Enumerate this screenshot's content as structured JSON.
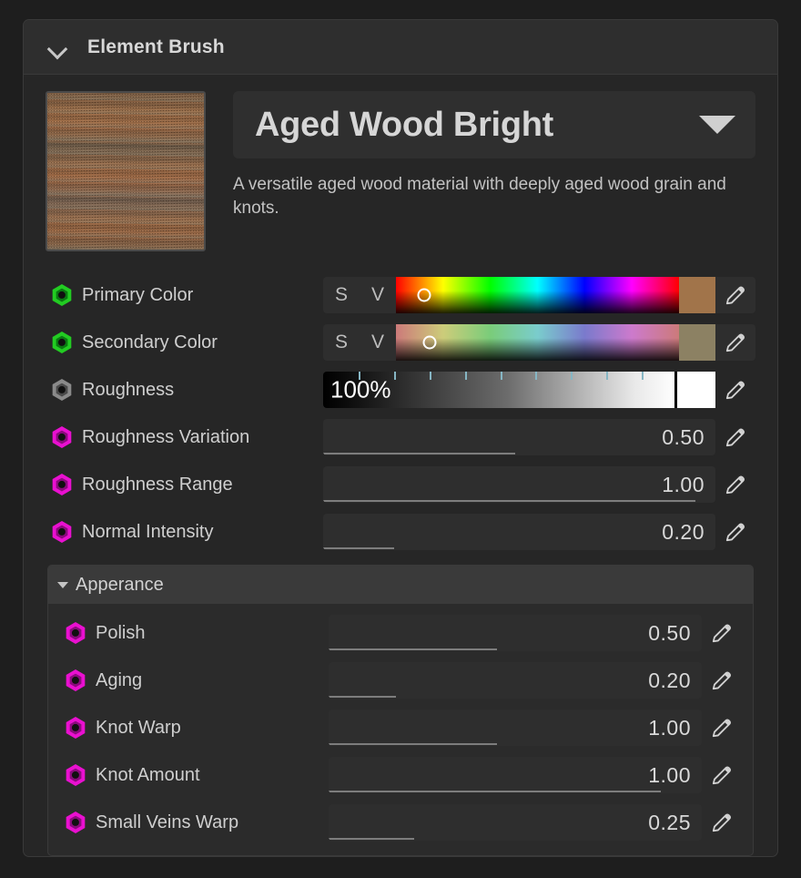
{
  "panel": {
    "title": "Element Brush",
    "collapse_icon": "chevron-down-icon"
  },
  "material": {
    "name": "Aged Wood Bright",
    "description": "A versatile aged wood material with deeply aged wood grain and knots.",
    "dropdown_icon": "caret-down-icon",
    "thumbnail_alt": "aged wood texture preview"
  },
  "colors": {
    "s_label": "S",
    "v_label": "V",
    "primary_swatch": "#a1744a",
    "secondary_swatch": "#8c8163",
    "primary_marker_pct": 10,
    "secondary_marker_pct": 12
  },
  "roughness": {
    "display": "100%",
    "fill_pct": 100,
    "tick_color": "#86b6c4",
    "swatch": "#ffffff"
  },
  "properties": [
    {
      "name": "Primary Color",
      "type": "color",
      "icon": "hexagon-green-icon",
      "icon_color": "#22cc22"
    },
    {
      "name": "Secondary Color",
      "type": "color",
      "icon": "hexagon-green-icon",
      "icon_color": "#22cc22"
    },
    {
      "name": "Roughness",
      "type": "ramp",
      "icon": "hexagon-gray-icon",
      "icon_color": "#8a8a8a",
      "value": "100%"
    },
    {
      "name": "Roughness Variation",
      "type": "number",
      "icon": "hexagon-magenta-icon",
      "icon_color": "#e910d0",
      "value": "0.50",
      "bar_pct": 49
    },
    {
      "name": "Roughness Range",
      "type": "number",
      "icon": "hexagon-magenta-icon",
      "icon_color": "#e910d0",
      "value": "1.00",
      "bar_pct": 95
    },
    {
      "name": "Normal Intensity",
      "type": "number",
      "icon": "hexagon-magenta-icon",
      "icon_color": "#e910d0",
      "value": "0.20",
      "bar_pct": 18
    }
  ],
  "group": {
    "title": "Apperance",
    "toggle_icon": "triangle-down-icon",
    "properties": [
      {
        "name": "Polish",
        "icon": "hexagon-magenta-icon",
        "icon_color": "#e910d0",
        "value": "0.50",
        "bar_pct": 45
      },
      {
        "name": "Aging",
        "icon": "hexagon-magenta-icon",
        "icon_color": "#e910d0",
        "value": "0.20",
        "bar_pct": 18
      },
      {
        "name": "Knot Warp",
        "icon": "hexagon-magenta-icon",
        "icon_color": "#e910d0",
        "value": "1.00",
        "bar_pct": 45
      },
      {
        "name": "Knot Amount",
        "icon": "hexagon-magenta-icon",
        "icon_color": "#e910d0",
        "value": "1.00",
        "bar_pct": 89
      },
      {
        "name": "Small Veins Warp",
        "icon": "hexagon-magenta-icon",
        "icon_color": "#e910d0",
        "value": "0.25",
        "bar_pct": 23
      }
    ]
  },
  "icons": {
    "edit": "pencil-icon"
  }
}
